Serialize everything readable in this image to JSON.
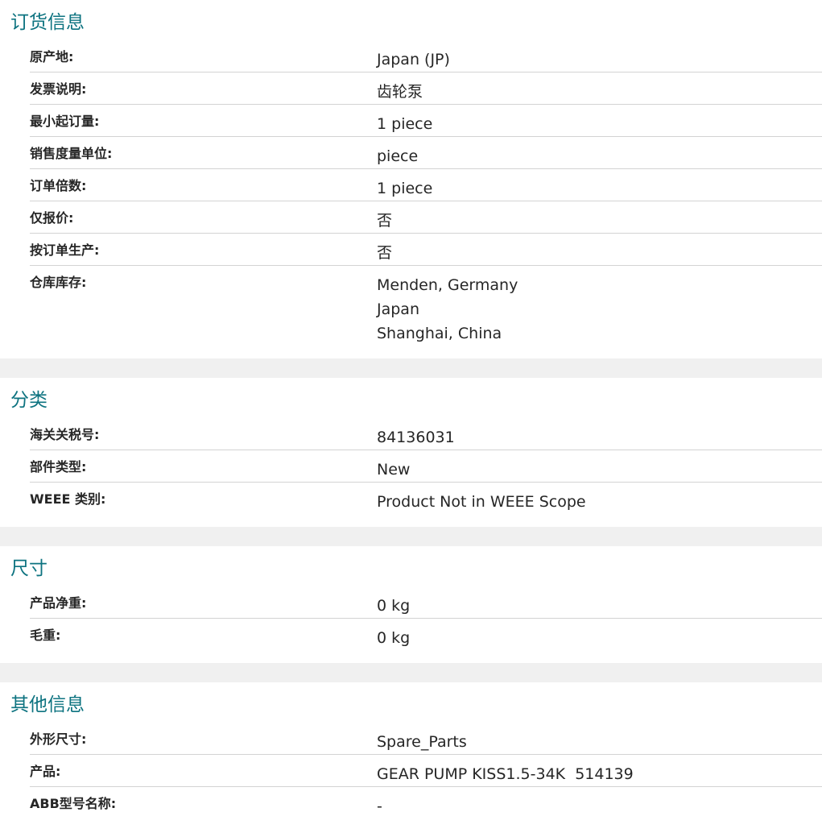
{
  "sections": [
    {
      "title": "订货信息",
      "rows": [
        {
          "label": "原产地:",
          "value": "Japan (JP)"
        },
        {
          "label": "发票说明:",
          "value": "齿轮泵"
        },
        {
          "label": "最小起订量:",
          "value": "1 piece"
        },
        {
          "label": "销售度量单位:",
          "value": "piece"
        },
        {
          "label": "订单倍数:",
          "value": "1 piece"
        },
        {
          "label": "仅报价:",
          "value": "否"
        },
        {
          "label": "按订单生产:",
          "value": "否"
        },
        {
          "label": "仓库库存:",
          "values": [
            "Menden, Germany",
            "Japan",
            "Shanghai, China"
          ]
        }
      ]
    },
    {
      "title": "分类",
      "rows": [
        {
          "label": "海关关税号:",
          "value": "84136031"
        },
        {
          "label": "部件类型:",
          "value": "New"
        },
        {
          "label": "WEEE 类别:",
          "value": "Product Not in WEEE Scope"
        }
      ]
    },
    {
      "title": "尺寸",
      "rows": [
        {
          "label": "产品净重:",
          "value": "0 kg"
        },
        {
          "label": "毛重:",
          "value": "0 kg"
        }
      ]
    },
    {
      "title": "其他信息",
      "rows": [
        {
          "label": "外形尺寸:",
          "value": "Spare_Parts"
        },
        {
          "label": "产品:",
          "value": "GEAR PUMP KISS1.5-34K  514139"
        },
        {
          "label": "ABB型号名称:",
          "value": "-"
        }
      ]
    }
  ],
  "colors": {
    "section_title": "#0d7380",
    "divider": "#d3d3d3",
    "gap_background": "#f0f0f0"
  }
}
